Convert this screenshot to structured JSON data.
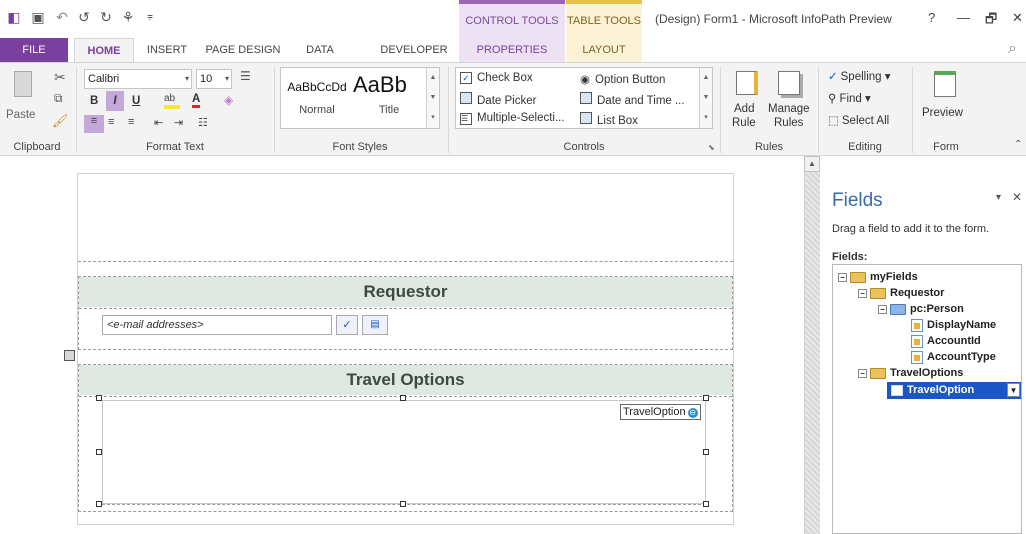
{
  "window": {
    "title": "(Design) Form1 - Microsoft InfoPath Preview",
    "help": "?",
    "minimize": "—",
    "restore": "🗗",
    "close": "✕"
  },
  "quick_access": {
    "icons": [
      "app-icon",
      "save-icon",
      "undo-icon",
      "undo-arrow-icon",
      "redo-icon",
      "preview-icon",
      "customize-icon"
    ]
  },
  "context_tabs": {
    "control_tools": "CONTROL TOOLS",
    "table_tools": "TABLE TOOLS"
  },
  "tabs": {
    "file": "FILE",
    "home": "HOME",
    "insert": "INSERT",
    "page_design": "PAGE DESIGN",
    "data": "DATA",
    "developer": "DEVELOPER",
    "properties": "PROPERTIES",
    "layout": "LAYOUT"
  },
  "ribbon": {
    "clipboard": {
      "label": "Clipboard",
      "paste": "Paste"
    },
    "format_text": {
      "label": "Format Text",
      "font_name": "Calibri",
      "font_size": "10",
      "bold": "B",
      "italic": "I",
      "underline": "U",
      "font_color": "A"
    },
    "font_styles": {
      "label": "Font Styles",
      "normal_sample": "AaBbCcDd",
      "normal_label": "Normal",
      "title_sample": "AaBb",
      "title_label": "Title"
    },
    "controls": {
      "label": "Controls",
      "items": [
        "Check Box",
        "Date Picker",
        "Multiple-Selecti...",
        "Option Button",
        "Date and Time ...",
        "List Box"
      ]
    },
    "rules": {
      "label": "Rules",
      "add_rule_1": "Add",
      "add_rule_2": "Rule",
      "manage_rules_1": "Manage",
      "manage_rules_2": "Rules"
    },
    "editing": {
      "label": "Editing",
      "spelling": "Spelling",
      "find": "Find",
      "select_all": "Select All"
    },
    "form": {
      "label": "Form",
      "preview": "Preview"
    }
  },
  "form": {
    "requestor_header": "Requestor",
    "email_placeholder": "<e-mail addresses>",
    "travel_header": "Travel Options",
    "travel_tag": "TravelOption"
  },
  "pane": {
    "title": "Fields",
    "hint": "Drag a field to add it to the form.",
    "fields_label": "Fields:",
    "tree": [
      {
        "label": "myFields",
        "type": "folder",
        "toggle": "⊟"
      },
      {
        "label": "Requestor",
        "type": "folder",
        "toggle": "⊟"
      },
      {
        "label": "pc:Person",
        "type": "group",
        "toggle": "⊟"
      },
      {
        "label": "DisplayName",
        "type": "field"
      },
      {
        "label": "AccountId",
        "type": "field"
      },
      {
        "label": "AccountType",
        "type": "field"
      },
      {
        "label": "TravelOptions",
        "type": "folder",
        "toggle": "⊟"
      },
      {
        "label": "TravelOption",
        "type": "repeating",
        "selected": true
      }
    ]
  },
  "colors": {
    "accent": "#7b3f9e",
    "control_tools_bg": "#ece2f3",
    "table_tools_bg": "#fcf2d6",
    "section_bg": "#dfe9e2",
    "selection": "#1b57c4"
  }
}
